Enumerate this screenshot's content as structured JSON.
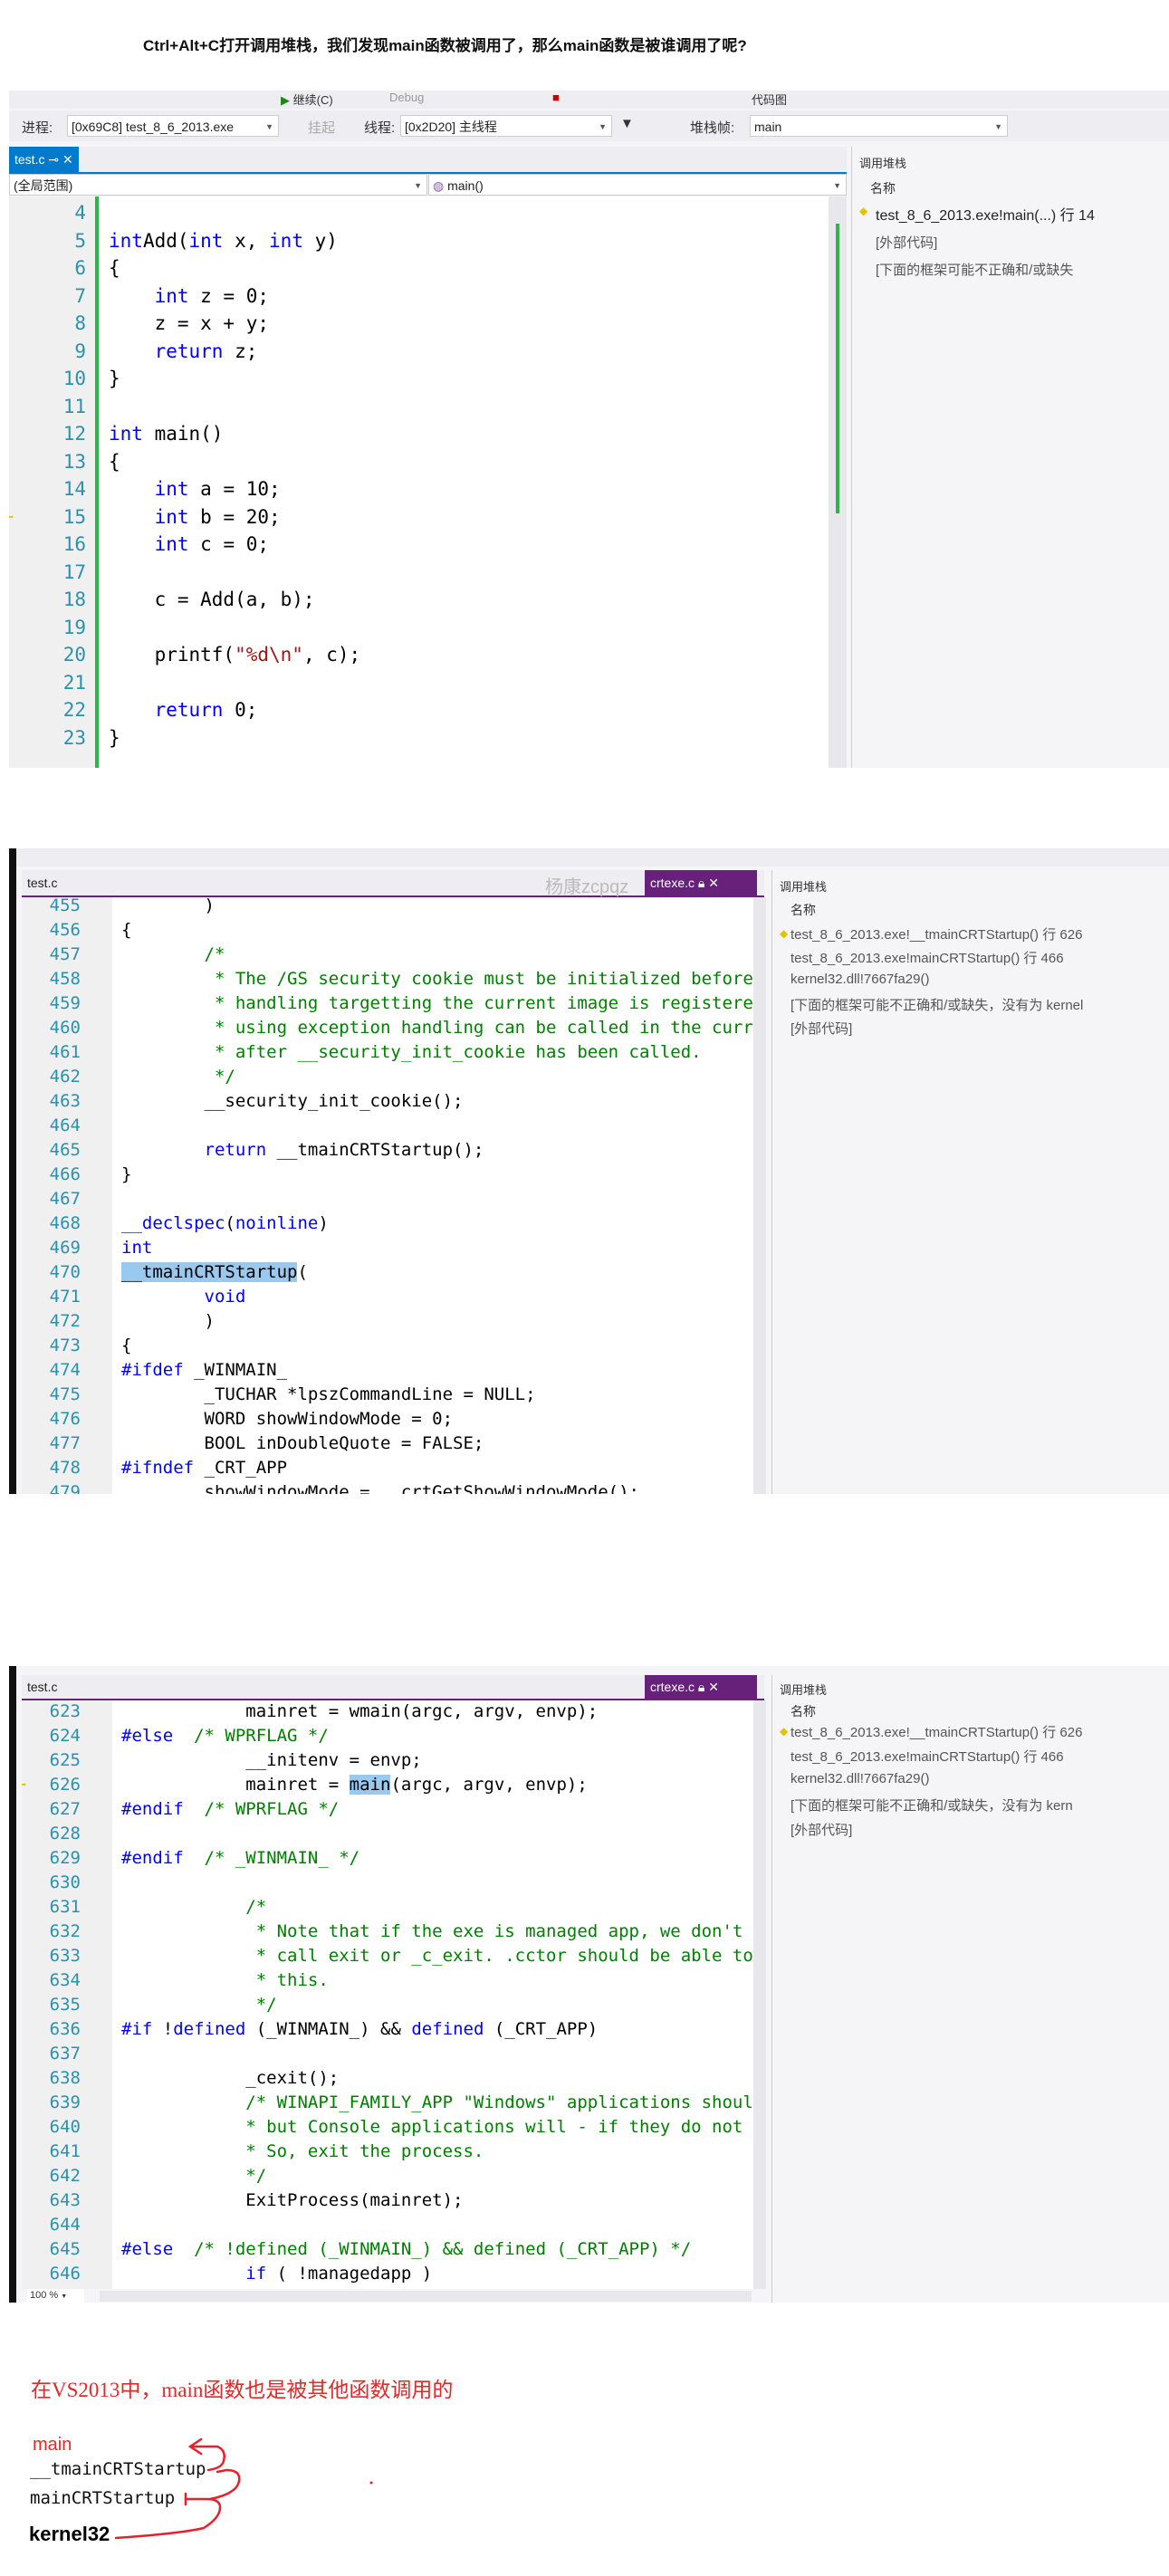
{
  "heading": "Ctrl+Alt+C打开调用堆栈，我们发现main函数被调用了，那么main函数是被谁调用了呢?",
  "colors": {
    "tab_blue": "#007acc",
    "tab_purple": "#68217a",
    "keyword": "#0000ff",
    "comment": "#008000",
    "line_number": "#2b91af",
    "annotation_red": "#e02a2a",
    "selection": "#99c9ef"
  },
  "panel1": {
    "toolbar": {
      "continue_label": "继续(C)",
      "config": "Debug",
      "codemap": "代码图",
      "process_label": "进程:",
      "process_value": "[0x69C8] test_8_6_2013.exe",
      "suspend_label": "挂起",
      "thread_label": "线程:",
      "thread_value": "[0x2D20] 主线程",
      "stackframe_label": "堆栈帧:",
      "stackframe_value": "main"
    },
    "tab": "test.c",
    "scope_dropdown": "(全局范围)",
    "function_dropdown": "main()",
    "code": [
      {
        "n": "4",
        "t": []
      },
      {
        "n": "5",
        "t": [
          [
            "k",
            "int"
          ],
          [
            "",
            "Add("
          ],
          [
            "k",
            "int"
          ],
          [
            "",
            " x, "
          ],
          [
            "k",
            "int"
          ],
          [
            "",
            " y)"
          ]
        ]
      },
      {
        "n": "6",
        "t": [
          [
            "",
            "{"
          ]
        ]
      },
      {
        "n": "7",
        "t": [
          [
            "",
            "    "
          ],
          [
            "k",
            "int"
          ],
          [
            "",
            " z = 0;"
          ]
        ]
      },
      {
        "n": "8",
        "t": [
          [
            "",
            "    z = x + y;"
          ]
        ]
      },
      {
        "n": "9",
        "t": [
          [
            "",
            "    "
          ],
          [
            "k",
            "return"
          ],
          [
            "",
            " z;"
          ]
        ]
      },
      {
        "n": "10",
        "t": [
          [
            "",
            "}"
          ]
        ]
      },
      {
        "n": "11",
        "t": []
      },
      {
        "n": "12",
        "t": [
          [
            "k",
            "int"
          ],
          [
            "",
            " main()"
          ]
        ]
      },
      {
        "n": "13",
        "t": [
          [
            "",
            "{"
          ]
        ]
      },
      {
        "n": "14",
        "t": [
          [
            "",
            "    "
          ],
          [
            "k",
            "int"
          ],
          [
            "",
            " a = 10;"
          ]
        ]
      },
      {
        "n": "15",
        "t": [
          [
            "",
            "    "
          ],
          [
            "k",
            "int"
          ],
          [
            "",
            " b = 20;"
          ]
        ]
      },
      {
        "n": "16",
        "t": [
          [
            "",
            "    "
          ],
          [
            "k",
            "int"
          ],
          [
            "",
            " c = 0;"
          ]
        ]
      },
      {
        "n": "17",
        "t": []
      },
      {
        "n": "18",
        "t": [
          [
            "",
            "    c = Add(a, b);"
          ]
        ]
      },
      {
        "n": "19",
        "t": []
      },
      {
        "n": "20",
        "t": [
          [
            "",
            "    printf("
          ],
          [
            "s",
            "\"%d\\n\""
          ],
          [
            "",
            ", c);"
          ]
        ]
      },
      {
        "n": "21",
        "t": []
      },
      {
        "n": "22",
        "t": [
          [
            "",
            "    "
          ],
          [
            "k",
            "return"
          ],
          [
            "",
            " 0;"
          ]
        ]
      },
      {
        "n": "23",
        "t": [
          [
            "",
            "}"
          ]
        ]
      }
    ],
    "callstack": {
      "title": "调用堆栈",
      "column": "名称",
      "items": [
        "test_8_6_2013.exe!main(...) 行 14",
        "[外部代码]",
        "[下面的框架可能不正确和/或缺失"
      ]
    }
  },
  "panel2": {
    "tab_inactive": "test.c",
    "tab_active": "crtexe.c",
    "watermark": "杨康zcpqz",
    "code": [
      {
        "n": "455",
        "t": [
          [
            "",
            "        )"
          ]
        ]
      },
      {
        "n": "456",
        "t": [
          [
            "",
            "{"
          ]
        ]
      },
      {
        "n": "457",
        "t": [
          [
            "c",
            "        /*"
          ]
        ]
      },
      {
        "n": "458",
        "t": [
          [
            "c",
            "         * The /GS security cookie must be initialized before"
          ]
        ]
      },
      {
        "n": "459",
        "t": [
          [
            "c",
            "         * handling targetting the current image is registere"
          ]
        ]
      },
      {
        "n": "460",
        "t": [
          [
            "c",
            "         * using exception handling can be called in the curr"
          ]
        ]
      },
      {
        "n": "461",
        "t": [
          [
            "c",
            "         * after __security_init_cookie has been called."
          ]
        ]
      },
      {
        "n": "462",
        "t": [
          [
            "c",
            "         */"
          ]
        ]
      },
      {
        "n": "463",
        "t": [
          [
            "",
            "        __security_init_cookie();"
          ]
        ]
      },
      {
        "n": "464",
        "t": []
      },
      {
        "n": "465",
        "t": [
          [
            "",
            "        "
          ],
          [
            "k",
            "return"
          ],
          [
            "",
            " __tmainCRTStartup();"
          ]
        ]
      },
      {
        "n": "466",
        "t": [
          [
            "",
            "}"
          ]
        ]
      },
      {
        "n": "467",
        "t": []
      },
      {
        "n": "468",
        "t": [
          [
            "k",
            "__declspec"
          ],
          [
            "",
            "("
          ],
          [
            "k",
            "noinline"
          ],
          [
            "",
            ")"
          ]
        ]
      },
      {
        "n": "469",
        "t": [
          [
            "k",
            "int"
          ]
        ]
      },
      {
        "n": "470",
        "t": [
          [
            "hl",
            "__tmainCRTStartup"
          ],
          [
            "",
            "("
          ]
        ]
      },
      {
        "n": "471",
        "t": [
          [
            "",
            "        "
          ],
          [
            "k",
            "void"
          ]
        ]
      },
      {
        "n": "472",
        "t": [
          [
            "",
            "        )"
          ]
        ]
      },
      {
        "n": "473",
        "t": [
          [
            "",
            "{"
          ]
        ]
      },
      {
        "n": "474",
        "t": [
          [
            "p",
            "#ifdef"
          ],
          [
            "",
            " _WINMAIN_"
          ]
        ]
      },
      {
        "n": "475",
        "t": [
          [
            "",
            "        _TUCHAR *lpszCommandLine = NULL;"
          ]
        ]
      },
      {
        "n": "476",
        "t": [
          [
            "",
            "        WORD showWindowMode = 0;"
          ]
        ]
      },
      {
        "n": "477",
        "t": [
          [
            "",
            "        BOOL inDoubleQuote = FALSE;"
          ]
        ]
      },
      {
        "n": "478",
        "t": [
          [
            "p",
            "#ifndef"
          ],
          [
            "",
            " _CRT_APP"
          ]
        ]
      },
      {
        "n": "479",
        "t": [
          [
            "",
            "        showWindowMode = __crtGetShowWindowMode();"
          ]
        ]
      }
    ],
    "callstack": {
      "title": "调用堆栈",
      "column": "名称",
      "items": [
        "test_8_6_2013.exe!__tmainCRTStartup() 行 626",
        "test_8_6_2013.exe!mainCRTStartup() 行 466",
        "kernel32.dll!7667fa29()",
        "[下面的框架可能不正确和/或缺失，没有为 kernel",
        "[外部代码]"
      ]
    }
  },
  "panel3": {
    "tab_inactive": "test.c",
    "tab_active": "crtexe.c",
    "zoom": "100 %",
    "code": [
      {
        "n": "623",
        "t": [
          [
            "",
            "            mainret = wmain(argc, argv, envp);"
          ]
        ]
      },
      {
        "n": "624",
        "t": [
          [
            "p",
            "#else"
          ],
          [
            "c",
            "  /* WPRFLAG */"
          ]
        ]
      },
      {
        "n": "625",
        "t": [
          [
            "",
            "            __initenv = envp;"
          ]
        ]
      },
      {
        "n": "626",
        "t": [
          [
            "",
            "            mainret = "
          ],
          [
            "hl",
            "main"
          ],
          [
            "",
            "(argc, argv, envp);"
          ]
        ]
      },
      {
        "n": "627",
        "t": [
          [
            "p",
            "#endif"
          ],
          [
            "c",
            "  /* WPRFLAG */"
          ]
        ]
      },
      {
        "n": "628",
        "t": []
      },
      {
        "n": "629",
        "t": [
          [
            "p",
            "#endif"
          ],
          [
            "c",
            "  /* _WINMAIN_ */"
          ]
        ]
      },
      {
        "n": "630",
        "t": []
      },
      {
        "n": "631",
        "t": [
          [
            "c",
            "            /*"
          ]
        ]
      },
      {
        "n": "632",
        "t": [
          [
            "c",
            "             * Note that if the exe is managed app, we don't"
          ]
        ]
      },
      {
        "n": "633",
        "t": [
          [
            "c",
            "             * call exit or _c_exit. .cctor should be able to"
          ]
        ]
      },
      {
        "n": "634",
        "t": [
          [
            "c",
            "             * this."
          ]
        ]
      },
      {
        "n": "635",
        "t": [
          [
            "c",
            "             */"
          ]
        ]
      },
      {
        "n": "636",
        "t": [
          [
            "p",
            "#if"
          ],
          [
            "",
            " !"
          ],
          [
            "k",
            "defined"
          ],
          [
            "",
            " (_WINMAIN_) && "
          ],
          [
            "k",
            "defined"
          ],
          [
            "",
            " (_CRT_APP)"
          ]
        ]
      },
      {
        "n": "637",
        "t": []
      },
      {
        "n": "638",
        "t": [
          [
            "",
            "            _cexit();"
          ]
        ]
      },
      {
        "n": "639",
        "t": [
          [
            "c",
            "            /* WINAPI_FAMILY_APP \"Windows\" applications shoul"
          ]
        ]
      },
      {
        "n": "640",
        "t": [
          [
            "c",
            "            * but Console applications will - if they do not"
          ]
        ]
      },
      {
        "n": "641",
        "t": [
          [
            "c",
            "            * So, exit the process."
          ]
        ]
      },
      {
        "n": "642",
        "t": [
          [
            "c",
            "            */"
          ]
        ]
      },
      {
        "n": "643",
        "t": [
          [
            "",
            "            ExitProcess(mainret);"
          ]
        ]
      },
      {
        "n": "644",
        "t": []
      },
      {
        "n": "645",
        "t": [
          [
            "p",
            "#else"
          ],
          [
            "c",
            "  /* !defined (_WINMAIN_) && defined (_CRT_APP) */"
          ]
        ]
      },
      {
        "n": "646",
        "t": [
          [
            "",
            "            "
          ],
          [
            "k",
            "if"
          ],
          [
            "",
            " ( !managedapp )"
          ]
        ]
      },
      {
        "n": "647",
        "t": [
          [
            "",
            "            {"
          ]
        ]
      }
    ],
    "callstack": {
      "title": "调用堆栈",
      "column": "名称",
      "items": [
        "test_8_6_2013.exe!__tmainCRTStartup() 行 626",
        "test_8_6_2013.exe!mainCRTStartup() 行 466",
        "kernel32.dll!7667fa29()",
        "[下面的框架可能不正确和/或缺失，没有为 kern",
        "[外部代码]"
      ]
    }
  },
  "annotation": {
    "sentence": "在VS2013中，main函数也是被其他函数调用的",
    "chain": [
      "main",
      "__tmainCRTStartup",
      "mainCRTStartup",
      "kernel32"
    ]
  }
}
